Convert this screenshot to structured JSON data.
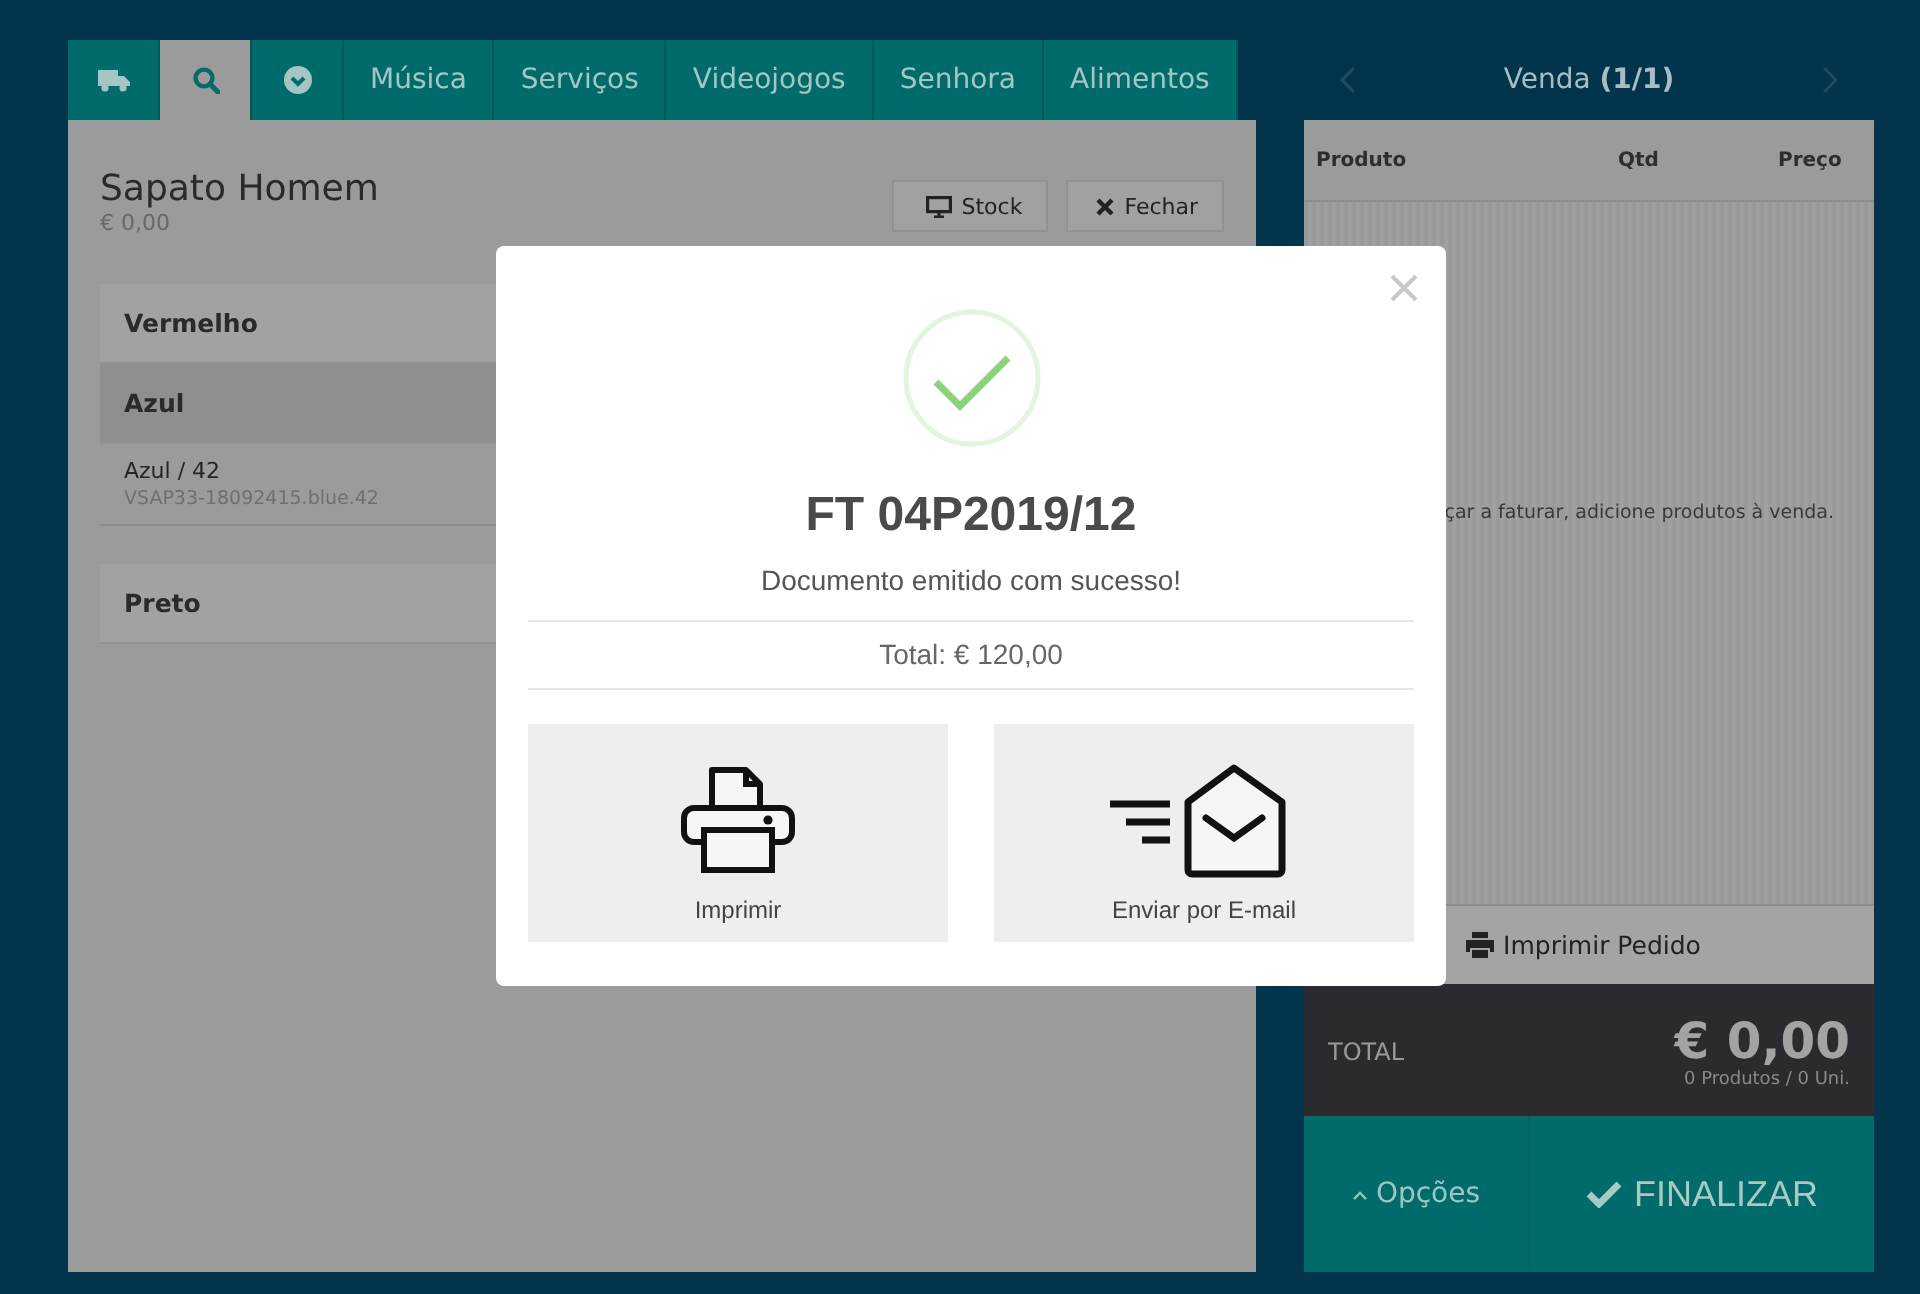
{
  "tabs": [
    {
      "selected": false
    },
    {
      "selected": true
    },
    {
      "selected": false
    },
    {
      "label": "Música",
      "selected": false
    },
    {
      "label": "Serviços",
      "selected": false
    },
    {
      "label": "Videojogos",
      "selected": false
    },
    {
      "label": "Senhora",
      "selected": false
    },
    {
      "label": "Alimentos",
      "selected": false
    }
  ],
  "product": {
    "name": "Sapato Homem",
    "price": "€ 0,00",
    "buttons": [
      "Stock",
      "Fechar"
    ]
  },
  "variants": [
    {
      "kind": "group",
      "label": "Vermelho",
      "expanded": false
    },
    {
      "kind": "group",
      "label": "Azul",
      "expanded": true
    },
    {
      "kind": "item",
      "name": "Azul / 42",
      "sku": "VSAP33-18092415.blue.42"
    },
    {
      "kind": "group",
      "label": "Preto",
      "expanded": false
    }
  ],
  "cart": {
    "title": "Venda **(1/1)**",
    "columns": [
      "Produto",
      "Qtd",
      "Preço"
    ],
    "empty_message": "çar a faturar, adicione produtos à venda.",
    "print_button": "Imprimir Pedido",
    "total_label": "TOTAL",
    "total": "€ 0,00",
    "summary": "0 Produtos / 0 Uni.",
    "options_button": "Opções",
    "finish_button": "FINALIZAR"
  },
  "modal": {
    "document": "FT 04P2019/12",
    "message": "Documento emitido com sucesso!",
    "total": "Total: € 120,00",
    "actions": [
      "Imprimir",
      "Enviar por E-mail"
    ]
  }
}
